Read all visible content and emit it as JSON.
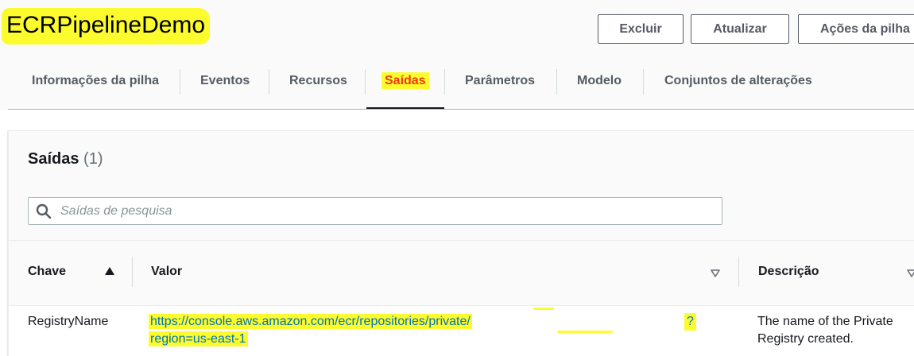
{
  "header": {
    "title": "ECRPipelineDemo",
    "delete_label": "Excluir",
    "update_label": "Atualizar",
    "actions_label": "Ações da pilha"
  },
  "tabs": [
    {
      "label": "Informações da pilha",
      "active": false
    },
    {
      "label": "Eventos",
      "active": false
    },
    {
      "label": "Recursos",
      "active": false
    },
    {
      "label": "Saídas",
      "active": true
    },
    {
      "label": "Parâmetros",
      "active": false
    },
    {
      "label": "Modelo",
      "active": false
    },
    {
      "label": "Conjuntos de alterações",
      "active": false
    }
  ],
  "outputs": {
    "title": "Saídas",
    "count": "(1)",
    "search_placeholder": "Saídas de pesquisa",
    "columns": {
      "key": "Chave",
      "value": "Valor",
      "description": "Descrição"
    },
    "rows": [
      {
        "key": "RegistryName",
        "value_line1": "https://console.aws.amazon.com/ecr/repositories/private/",
        "value_line2": "region=us-east-1",
        "value_qmark": "?",
        "description": "The name of the Private Registry created."
      }
    ]
  },
  "colors": {
    "highlight": "#fbfb2e",
    "link": "#0073bb",
    "active_tab": "#ec7211",
    "border": "#aab7b8"
  },
  "icons": {
    "search": "search-icon",
    "sort_asc": "sort-ascending-icon",
    "sort_desc": "sort-descending-icon"
  }
}
